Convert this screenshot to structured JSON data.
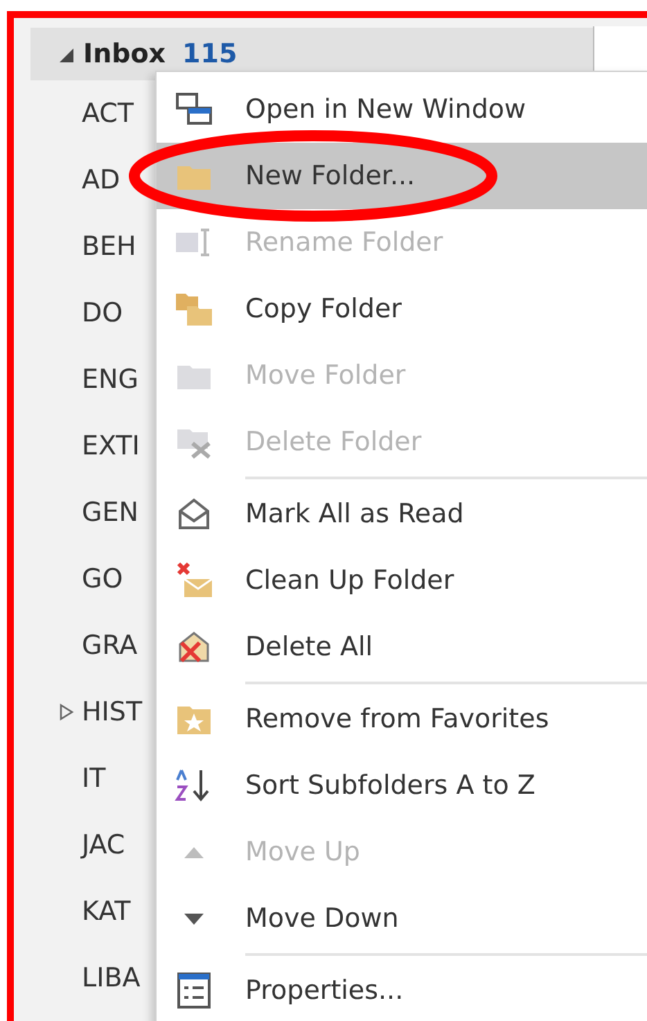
{
  "folder_pane": {
    "inbox": {
      "label": "Inbox",
      "count": "115",
      "expanded": true
    },
    "folders": [
      {
        "label": "ACT",
        "expandable": false
      },
      {
        "label": "AD",
        "expandable": false
      },
      {
        "label": "BEH",
        "expandable": false
      },
      {
        "label": "DO",
        "expandable": false
      },
      {
        "label": "ENG",
        "expandable": false
      },
      {
        "label": "EXTI",
        "expandable": false
      },
      {
        "label": "GEN",
        "expandable": false
      },
      {
        "label": "GO",
        "expandable": false
      },
      {
        "label": "GRA",
        "expandable": false
      },
      {
        "label": "HIST",
        "expandable": true
      },
      {
        "label": "IT",
        "expandable": false
      },
      {
        "label": "JAC",
        "expandable": false
      },
      {
        "label": "KAT",
        "expandable": false
      },
      {
        "label": "LIBA",
        "expandable": false
      }
    ]
  },
  "context_menu": {
    "items": [
      {
        "kind": "item",
        "label": "Open in New Window",
        "disabled": false,
        "selected": false
      },
      {
        "kind": "item",
        "label": "New Folder...",
        "disabled": false,
        "selected": true
      },
      {
        "kind": "item",
        "label": "Rename Folder",
        "disabled": true,
        "selected": false
      },
      {
        "kind": "item",
        "label": "Copy Folder",
        "disabled": false,
        "selected": false
      },
      {
        "kind": "item",
        "label": "Move Folder",
        "disabled": true,
        "selected": false
      },
      {
        "kind": "item",
        "label": "Delete Folder",
        "disabled": true,
        "selected": false
      },
      {
        "kind": "separator"
      },
      {
        "kind": "item",
        "label": "Mark All as Read",
        "disabled": false,
        "selected": false
      },
      {
        "kind": "item",
        "label": "Clean Up Folder",
        "disabled": false,
        "selected": false
      },
      {
        "kind": "item",
        "label": "Delete All",
        "disabled": false,
        "selected": false
      },
      {
        "kind": "separator"
      },
      {
        "kind": "item",
        "label": "Remove from Favorites",
        "disabled": false,
        "selected": false
      },
      {
        "kind": "item",
        "label": "Sort Subfolders A to Z",
        "disabled": false,
        "selected": false
      },
      {
        "kind": "item",
        "label": "Move Up",
        "disabled": true,
        "selected": false
      },
      {
        "kind": "item",
        "label": "Move Down",
        "disabled": false,
        "selected": false
      },
      {
        "kind": "separator"
      },
      {
        "kind": "item",
        "label": "Properties...",
        "disabled": false,
        "selected": false
      }
    ]
  }
}
